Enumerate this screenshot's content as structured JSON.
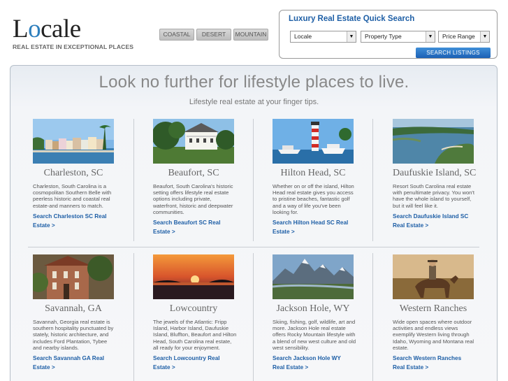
{
  "logo": {
    "word_before": "L",
    "word_o": "o",
    "word_after": "cale",
    "tagline": "REAL ESTATE IN EXCEPTIONAL PLACES"
  },
  "categories": [
    "COASTAL",
    "DESERT",
    "MOUNTAIN"
  ],
  "quick_search": {
    "title": "Luxury Real Estate Quick Search",
    "locale": "Locale",
    "property_type": "Property Type",
    "price_range": "Price Range",
    "button": "SEARCH LISTINGS"
  },
  "headline": "Look no further for lifestyle places to live.",
  "subhead": "Lifestyle real estate at your finger tips.",
  "places": [
    {
      "name": "Charleston, SC",
      "desc": "Charleston, South Carolina is a cosmopolitan Southern Belle with peerless historic and coastal real estate-and manners to match.",
      "link": "Search Charleston SC Real Estate >"
    },
    {
      "name": "Beaufort, SC",
      "desc": "Beaufort, South Carolina's historic setting offers lifestyle real estate options including private, waterfront, historic and deepwater communities.",
      "link": "Search Beaufort SC Real Estate >"
    },
    {
      "name": "Hilton Head, SC",
      "desc": "Whether on or off the island, Hilton Head real estate gives you access to pristine beaches, fantastic golf and a way of life you've been looking for.",
      "link": "Search Hilton Head SC Real Estate >"
    },
    {
      "name": "Daufuskie Island, SC",
      "desc": "Resort South Carolina real estate with penultimate privacy. You won't have the whole island to yourself, but it will feel like it.",
      "link": "Search Daufuskie Island SC Real Estate >"
    },
    {
      "name": "Savannah, GA",
      "desc": "Savannah, Georgia real estate is southern hospitality punctuated by stately, historic architecture, and includes Ford Plantation, Tybee and nearby islands.",
      "link": "Search Savannah GA Real Estate >"
    },
    {
      "name": "Lowcountry",
      "desc": "The jewels of the Atlantic: Fripp Island, Harbor Island, Daufuskie Island, Bluffton, Beaufort and Hilton Head, South Carolina real estate, all ready for your enjoyment.",
      "link": "Search Lowcountry Real Estate >"
    },
    {
      "name": "Jackson Hole, WY",
      "desc": "Skiing, fishing, golf, wildlife, art and more. Jackson Hole real estate offers Rocky Mountain lifestyle with a blend of new west culture and old west sensibility.",
      "link": "Search Jackson Hole WY Real Estate >"
    },
    {
      "name": "Western Ranches",
      "desc": "Wide open spaces where outdoor activities and endless views exemplify Western living through Idaho, Wyoming and Montana real estate.",
      "link": "Search Western Ranches Real Estate >"
    }
  ],
  "colors": {
    "link": "#1e5fa6",
    "accent": "#2e7fbd",
    "button": "#1b60b5"
  }
}
